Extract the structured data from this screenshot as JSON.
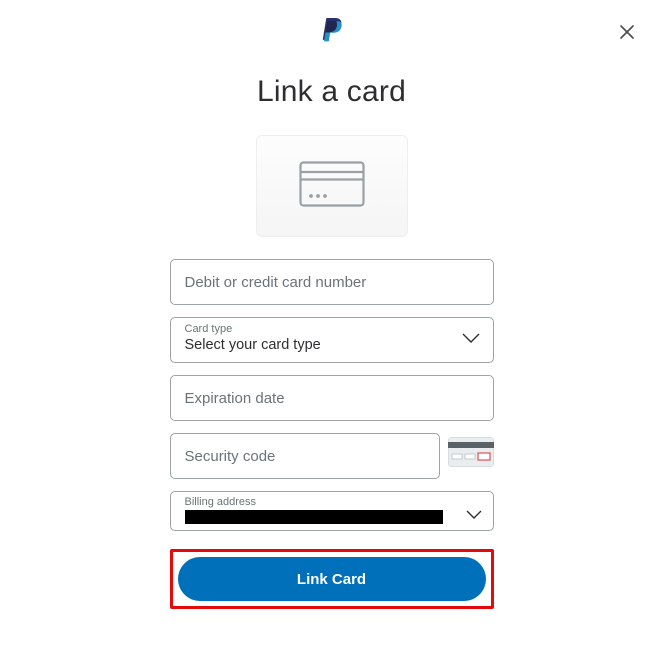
{
  "title": "Link a card",
  "fields": {
    "card_number": {
      "placeholder": "Debit or credit card number",
      "value": ""
    },
    "card_type": {
      "label": "Card type",
      "value": "Select your card type"
    },
    "expiration": {
      "placeholder": "Expiration date",
      "value": ""
    },
    "security": {
      "placeholder": "Security code",
      "value": ""
    },
    "billing": {
      "label": "Billing address",
      "value": ""
    }
  },
  "submit_label": "Link Card",
  "colors": {
    "accent": "#0070ba",
    "highlight": "#e20a0a"
  }
}
